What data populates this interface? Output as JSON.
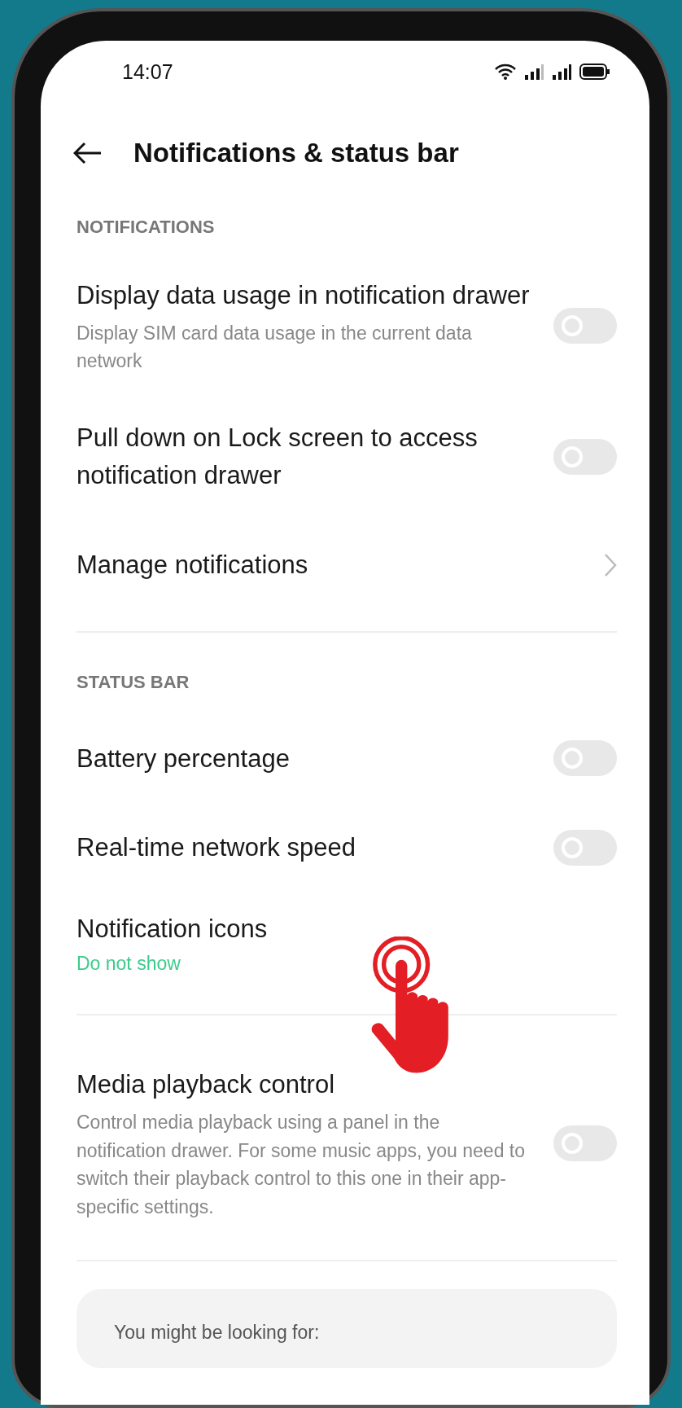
{
  "status_bar": {
    "time": "14:07"
  },
  "header": {
    "title": "Notifications & status bar"
  },
  "sections": [
    {
      "heading": "NOTIFICATIONS",
      "items": [
        {
          "kind": "toggle",
          "title": "Display data usage in notification drawer",
          "subtitle": "Display SIM card data usage in the current data network",
          "on": false
        },
        {
          "kind": "toggle",
          "title": "Pull down on Lock screen to access notification drawer",
          "on": false
        },
        {
          "kind": "link",
          "title": "Manage notifications"
        }
      ]
    },
    {
      "heading": "STATUS BAR",
      "items": [
        {
          "kind": "toggle",
          "title": "Battery percentage",
          "on": false
        },
        {
          "kind": "toggle",
          "title": "Real-time network speed",
          "on": false
        },
        {
          "kind": "value",
          "title": "Notification icons",
          "value": "Do not show"
        }
      ]
    },
    {
      "items": [
        {
          "kind": "toggle",
          "title": "Media playback control",
          "subtitle": "Control media playback using a panel in the notification drawer. For some music apps, you need to switch their playback control to this one in their app-specific settings.",
          "on": false
        }
      ]
    }
  ],
  "suggestion": {
    "text": "You might be looking for:"
  }
}
